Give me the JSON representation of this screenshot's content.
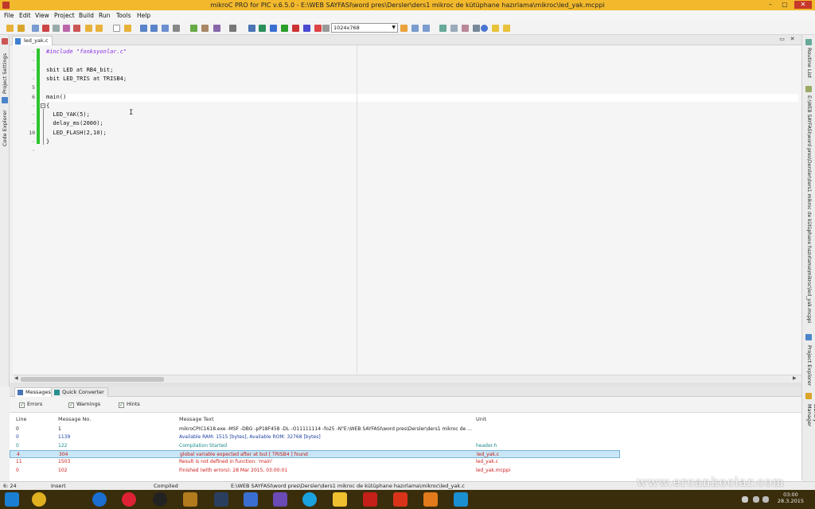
{
  "window": {
    "title": "mikroC PRO for PIC v.6.5.0 - E:\\WEB SAYFASI\\word pres\\Dersler\\ders1 mikroc de kütüphane hazırlama\\mikroc\\led_yak.mcppi",
    "minimize": "–",
    "maximize": "▢",
    "close": "✕"
  },
  "menu": [
    "File",
    "Edit",
    "View",
    "Project",
    "Build",
    "Run",
    "Tools",
    "Help"
  ],
  "toolbar": {
    "resolution": "1024x768"
  },
  "left_panel": {
    "project_settings": "Project Settings",
    "code_explorer": "Code Explorer"
  },
  "right_panel": {
    "routine_list": "Routine List",
    "project_path": "E:\\WEB SAYFASI\\word pres\\Dersler\\ders1 mikroc de kütüphane hazırlama\\mikroc\\led_yak.mcppi",
    "project_explorer": "Project Explorer",
    "library_manager": "Library Manager"
  },
  "editor": {
    "tab": "led_yak.c",
    "lines": [
      {
        "n": "·",
        "code": "#include \"fonksyonlar.c\"",
        "kind": "pre"
      },
      {
        "n": "·",
        "code": "",
        "kind": "plain"
      },
      {
        "n": "·",
        "code": "sbit LED at RB4_bit;",
        "kind": "plain"
      },
      {
        "n": "·",
        "code": "sbit LED_TRIS at TRISB4;",
        "kind": "plain"
      },
      {
        "n": "5",
        "code": "",
        "kind": "plain"
      },
      {
        "n": "6",
        "code": "main()",
        "kind": "plain"
      },
      {
        "n": "·",
        "code": "{",
        "kind": "plain"
      },
      {
        "n": "·",
        "code": "  LED_YAK(5);",
        "kind": "call"
      },
      {
        "n": "·",
        "code": "  delay_ms(2000);",
        "kind": "call"
      },
      {
        "n": "10",
        "code": "  LED_FLASH(2,10);",
        "kind": "call"
      },
      {
        "n": "·",
        "code": "}",
        "kind": "plain"
      },
      {
        "n": "·",
        "code": "",
        "kind": "plain"
      }
    ]
  },
  "messages": {
    "tabs": [
      "Messages",
      "Quick Converter"
    ],
    "filters": [
      "Errors",
      "Warnings",
      "Hints"
    ],
    "headers": [
      "Line",
      "Message No.",
      "Message Text",
      "Unit"
    ],
    "rows": [
      {
        "line": "0",
        "no": "1",
        "text": "mikroCPIC1618.exe -MSF -DBG -pP18F458 -DL -O11111114 -fo25 -N\"E:\\WEB SAYFASI\\word pres\\Dersler\\ders1 mikroc de ...",
        "unit": "",
        "type": "normal"
      },
      {
        "line": "0",
        "no": "1139",
        "text": "Available RAM: 1515 [bytes], Available ROM: 32768 [bytes]",
        "unit": "",
        "type": "info"
      },
      {
        "line": "0",
        "no": "122",
        "text": "Compilation Started",
        "unit": "header.h",
        "type": "hint"
      },
      {
        "line": "4",
        "no": "304",
        "text": "global variable expected after at but [ TRISB4 ] found",
        "unit": "led_yak.c",
        "type": "error"
      },
      {
        "line": "11",
        "no": "1503",
        "text": "Result is not defined in function: 'main'",
        "unit": "led_yak.c",
        "type": "error"
      },
      {
        "line": "0",
        "no": "102",
        "text": "Finished (with errors): 28 Mar 2015, 03:00:01",
        "unit": "led_yak.mcppi",
        "type": "error"
      }
    ]
  },
  "status": {
    "position": "6: 24",
    "mode": "Insert",
    "state": "Compiled",
    "path": "E:\\WEB SAYFASI\\word pres\\Dersler\\ders1 mikroc de kütüphane hazırlama\\mikroc\\led_yak.c"
  },
  "taskbar": {
    "time": "03:00",
    "date": "28.3.2015"
  },
  "watermark": "www.ercankoclar.com",
  "colors": {
    "titlebar": "#f2b92d",
    "changebar": "#2ec52e",
    "selected_row": "#c8e6f5",
    "error_text": "#cc1a1a",
    "info_text": "#1a3fa0",
    "hint_text": "#1a8a8a",
    "preprocessor": "#8a2be2"
  }
}
